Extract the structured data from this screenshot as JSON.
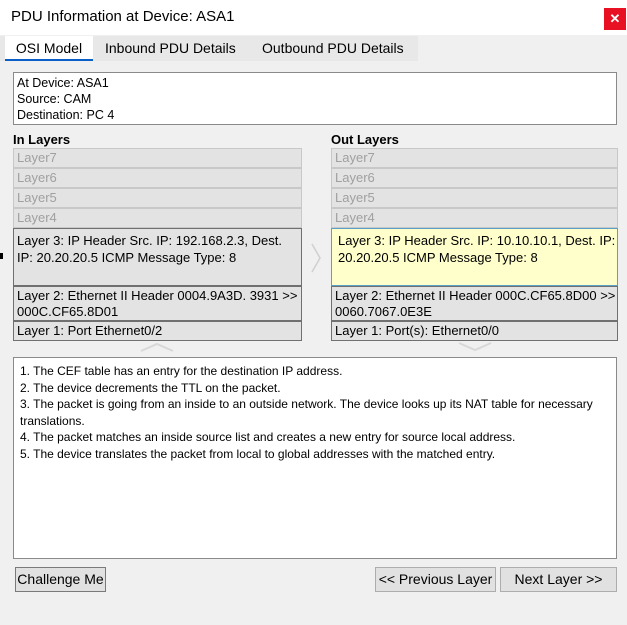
{
  "window": {
    "title": "PDU Information at Device: ASA1",
    "close_icon": "close-icon"
  },
  "tabs": [
    {
      "label": "OSI Model",
      "active": true
    },
    {
      "label": "Inbound PDU Details",
      "active": false
    },
    {
      "label": "Outbound PDU Details",
      "active": false
    }
  ],
  "info": {
    "device": "At Device: ASA1",
    "source": "Source: CAM",
    "destination": "Destination: PC 4"
  },
  "in_layers": {
    "heading": "In Layers",
    "layer7": "Layer7",
    "layer6": "Layer6",
    "layer5": "Layer5",
    "layer4": "Layer4",
    "layer3": "Layer 3: IP Header Src. IP: 192.168.2.3, Dest. IP: 20.20.20.5 ICMP Message Type: 8",
    "layer2": "Layer 2: Ethernet II Header 0004.9A3D. 3931 >> 000C.CF65.8D01",
    "layer1": "Layer 1: Port Ethernet0/2"
  },
  "out_layers": {
    "heading": "Out Layers",
    "layer7": "Layer7",
    "layer6": "Layer6",
    "layer5": "Layer5",
    "layer4": "Layer4",
    "layer3": "Layer 3: IP Header Src. IP: 10.10.10.1, Dest. IP: 20.20.20.5 ICMP Message Type: 8",
    "layer2": "Layer 2: Ethernet II Header 000C.CF65.8D00 >> 0060.7067.0E3E",
    "layer1": "Layer 1: Port(s): Ethernet0/0"
  },
  "notes": [
    "1. The CEF table has an entry for the destination IP address.",
    "2. The device decrements the TTL on the packet.",
    "3. The packet is going from an inside to an outside network. The device looks up its NAT table for necessary translations.",
    "4. The packet matches an inside source list and creates a new entry for source local address.",
    "5. The device translates the packet from local to global addresses with the matched entry."
  ],
  "buttons": {
    "challenge": "Challenge Me",
    "previous": "<< Previous Layer",
    "next": "Next Layer >>"
  },
  "colors": {
    "highlight": "#ffffcc",
    "close": "#e81123",
    "tab_underline": "#0a5ec8"
  }
}
